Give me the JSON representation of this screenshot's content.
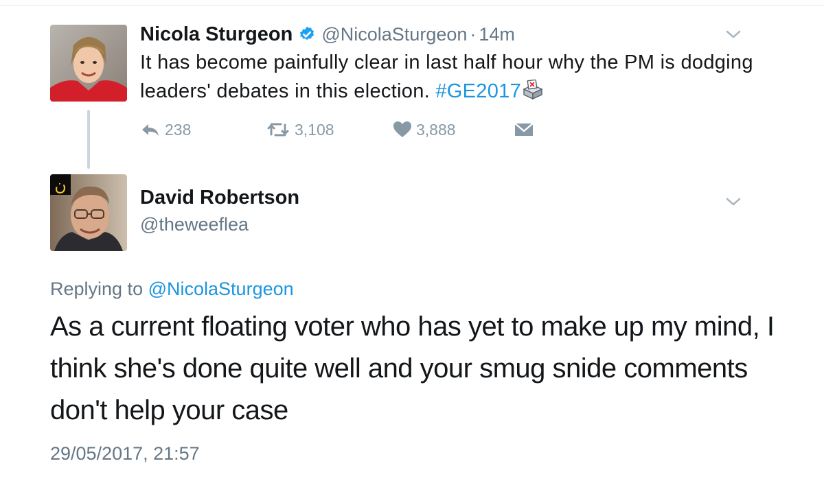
{
  "tweet": {
    "author_name": "Nicola Sturgeon",
    "handle": "@NicolaSturgeon",
    "separator": "·",
    "time": "14m",
    "text_before_hashtag": "It has become painfully clear in last half hour why the PM is dodging leaders' debates in this election. ",
    "hashtag": "#GE2017",
    "hashtag_emoji": "ballot-box-icon",
    "reply_count": "238",
    "retweet_count": "3,108",
    "like_count": "3,888",
    "verified": true
  },
  "reply": {
    "author_name": "David Robertson",
    "handle": "@theweeflea",
    "replying_to_label": "Replying to",
    "replying_to_handle": "@NicolaSturgeon",
    "text": "As a current floating voter who has yet to make up my mind, I think she's done quite well and your smug snide comments don't help your case",
    "timestamp": "29/05/2017, 21:57",
    "avatar_badge": "ن"
  },
  "colors": {
    "link": "#1b95e0",
    "secondary_text": "#657786",
    "icon_gray": "#8899a6",
    "verified_blue": "#1da1f2",
    "divider": "#e1e8ed"
  }
}
